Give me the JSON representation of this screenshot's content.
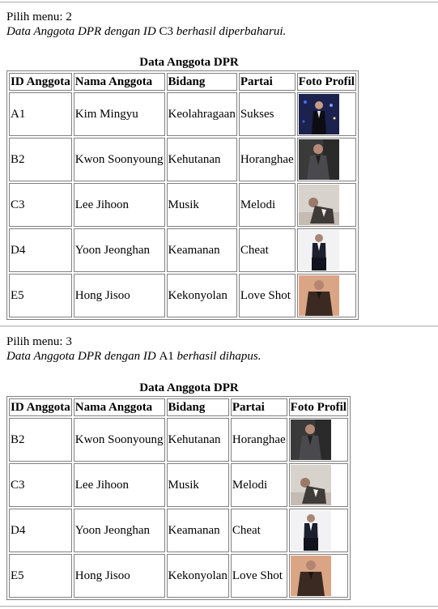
{
  "columns": [
    "ID Anggota",
    "Nama Anggota",
    "Bidang",
    "Partai",
    "Foto Profil"
  ],
  "sections": [
    {
      "menu": "Pilih menu: 2",
      "msg_prefix": "Data Anggota DPR dengan ID ",
      "msg_id": "C3",
      "msg_suffix": " berhasil diperbaharui.",
      "table_title": "Data Anggota DPR",
      "rows": [
        {
          "id": "A1",
          "nama": "Kim Mingyu",
          "bidang": "Keolahragaan",
          "partai": "Sukses",
          "foto": "profile-photo-kim-mingyu"
        },
        {
          "id": "B2",
          "nama": "Kwon Soonyoung",
          "bidang": "Kehutanan",
          "partai": "Horanghae",
          "foto": "profile-photo-kwon-soonyoung"
        },
        {
          "id": "C3",
          "nama": "Lee Jihoon",
          "bidang": "Musik",
          "partai": "Melodi",
          "foto": "profile-photo-lee-jihoon"
        },
        {
          "id": "D4",
          "nama": "Yoon Jeonghan",
          "bidang": "Keamanan",
          "partai": "Cheat",
          "foto": "profile-photo-yoon-jeonghan"
        },
        {
          "id": "E5",
          "nama": "Hong Jisoo",
          "bidang": "Kekonyolan",
          "partai": "Love Shot",
          "foto": "profile-photo-hong-jisoo"
        }
      ]
    },
    {
      "menu": "Pilih menu: 3",
      "msg_prefix": "Data Anggota DPR dengan ID ",
      "msg_id": "A1",
      "msg_suffix": " berhasil dihapus.",
      "table_title": "Data Anggota DPR",
      "rows": [
        {
          "id": "B2",
          "nama": "Kwon Soonyoung",
          "bidang": "Kehutanan",
          "partai": "Horanghae",
          "foto": "profile-photo-kwon-soonyoung"
        },
        {
          "id": "C3",
          "nama": "Lee Jihoon",
          "bidang": "Musik",
          "partai": "Melodi",
          "foto": "profile-photo-lee-jihoon"
        },
        {
          "id": "D4",
          "nama": "Yoon Jeonghan",
          "bidang": "Keamanan",
          "partai": "Cheat",
          "foto": "profile-photo-yoon-jeonghan"
        },
        {
          "id": "E5",
          "nama": "Hong Jisoo",
          "bidang": "Kekonyolan",
          "partai": "Love Shot",
          "foto": "profile-photo-hong-jisoo"
        }
      ]
    }
  ]
}
